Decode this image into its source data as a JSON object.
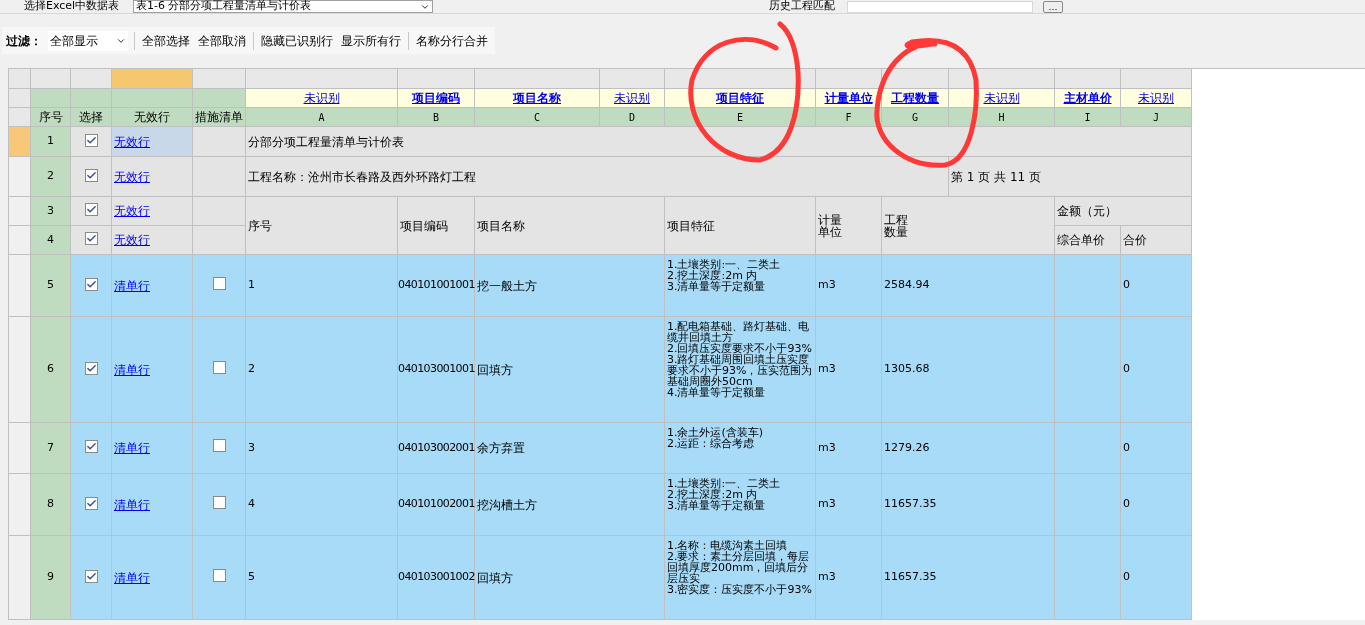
{
  "data_source": {
    "label": "选择Excel中数据表",
    "value": "表1-6 分部分项工程量清单与计价表"
  },
  "history_match": {
    "label": "历史工程匹配",
    "button": "…"
  },
  "toolbar": {
    "filter_label": "过滤：",
    "filter_value": "全部显示",
    "groups": [
      [
        "全部选择",
        "全部取消"
      ],
      [
        "隐藏已识别行",
        "显示所有行"
      ],
      [
        "名称分行合并"
      ]
    ]
  },
  "grid": {
    "fixed_columns": [
      {
        "label": "序号",
        "selected": false
      },
      {
        "label": "选择",
        "selected": false
      },
      {
        "label": "无效行",
        "selected": true
      },
      {
        "label": "措施清单",
        "selected": false
      }
    ],
    "columns": [
      {
        "mapping": "未识别",
        "recognized": false,
        "letter": "A"
      },
      {
        "mapping": "项目编码",
        "recognized": true,
        "letter": "B"
      },
      {
        "mapping": "项目名称",
        "recognized": true,
        "letter": "C"
      },
      {
        "mapping": "未识别",
        "recognized": false,
        "letter": "D"
      },
      {
        "mapping": "项目特征",
        "recognized": true,
        "letter": "E"
      },
      {
        "mapping": "计量单位",
        "recognized": true,
        "letter": "F"
      },
      {
        "mapping": "工程数量",
        "recognized": true,
        "letter": "G"
      },
      {
        "mapping": "未识别",
        "recognized": false,
        "letter": "H"
      },
      {
        "mapping": "主材单价",
        "recognized": true,
        "letter": "I"
      },
      {
        "mapping": "未识别",
        "recognized": false,
        "letter": "J"
      }
    ],
    "rows": [
      {
        "kind": "title",
        "number": "1",
        "checked": true,
        "row_type": "无效行",
        "selected": true,
        "text": "分部分项工程量清单与计价表"
      },
      {
        "kind": "project",
        "number": "2",
        "checked": true,
        "row_type": "无效行",
        "selected": false,
        "text": "工程名称：沧州市长春路及西外环路灯工程",
        "page": "第 1 页  共 11 页"
      },
      {
        "kind": "header",
        "number": "3",
        "checked": true,
        "row_type": "无效行",
        "selected": false,
        "seq": "序号",
        "code": "项目编码",
        "name": "项目名称",
        "feature": "项目特征",
        "unit": "计量单位",
        "quantity": "工程数量",
        "amount": "金额（元）"
      },
      {
        "kind": "subheader",
        "number": "4",
        "checked": true,
        "row_type": "无效行",
        "selected": false,
        "unit_price": "综合单价",
        "total": "合价"
      },
      {
        "kind": "item",
        "number": "5",
        "checked": true,
        "row_type": "清单行",
        "selected": false,
        "measure": false,
        "seq": "1",
        "code": "040101001001",
        "name": "挖一般土方",
        "feature": "1.土壤类别:一、二类土\n2.挖土深度:2m 内\n3.清单量等于定额量",
        "unit": "m3",
        "quantity": "2584.94",
        "total": "0"
      },
      {
        "kind": "item",
        "number": "6",
        "checked": true,
        "row_type": "清单行",
        "selected": false,
        "measure": false,
        "seq": "2",
        "code": "040103001001",
        "name": "回填方",
        "feature": "1.配电箱基础、路灯基础、电缆井回填土方\n2.回填压实度要求不小于93%\n3.路灯基础周围回填土压实度要求不小于93%，压实范围为基础周圈外50cm\n4.清单量等于定额量",
        "unit": "m3",
        "quantity": "1305.68",
        "total": "0"
      },
      {
        "kind": "item",
        "number": "7",
        "checked": true,
        "row_type": "清单行",
        "selected": false,
        "measure": false,
        "seq": "3",
        "code": "040103002001",
        "name": "余方弃置",
        "feature": "1.余土外运(含装车)\n2.运距：综合考虑",
        "unit": "m3",
        "quantity": "1279.26",
        "total": "0"
      },
      {
        "kind": "item",
        "number": "8",
        "checked": true,
        "row_type": "清单行",
        "selected": false,
        "measure": false,
        "seq": "4",
        "code": "040101002001",
        "name": "挖沟槽土方",
        "feature": "1.土壤类别:一、二类土\n2.挖土深度:2m 内\n3.清单量等于定额量",
        "unit": "m3",
        "quantity": "11657.35",
        "total": "0"
      },
      {
        "kind": "item",
        "number": "9",
        "checked": true,
        "row_type": "清单行",
        "selected": false,
        "measure": false,
        "seq": "5",
        "code": "040103001002",
        "name": "回填方",
        "feature": "1.名称：电缆沟素土回填\n2.要求：素土分层回填，每层回填厚度200mm，回填后分层压实\n3.密实度：压实度不小于93%",
        "unit": "m3",
        "quantity": "11657.35",
        "total": "0"
      }
    ]
  }
}
